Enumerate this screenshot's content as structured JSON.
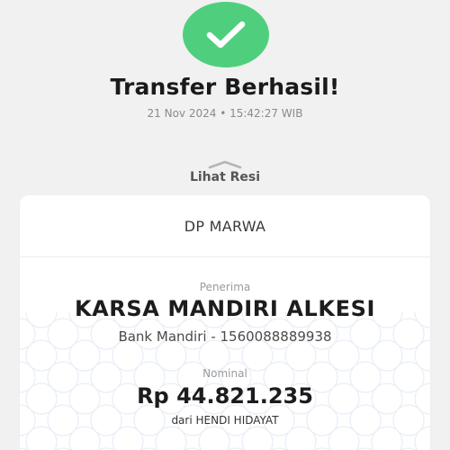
{
  "status": {
    "icon": "check-icon",
    "title": "Transfer Berhasil!",
    "datetime": "21 Nov 2024 • 15:42:27 WIB"
  },
  "receipt_toggle": {
    "icon": "chevron-up-icon",
    "label": "Lihat Resi"
  },
  "card": {
    "title": "DP MARWA",
    "recipient": {
      "label": "Penerima",
      "name": "KARSA MANDIRI ALKESI",
      "bank_account": "Bank Mandiri - 1560088889938"
    },
    "amount": {
      "label": "Nominal",
      "value": "Rp 44.821.235",
      "sender": "dari HENDI HIDAYAT"
    }
  },
  "colors": {
    "success": "#4fcf7d",
    "background": "#f1f1f1",
    "card": "#ffffff"
  }
}
